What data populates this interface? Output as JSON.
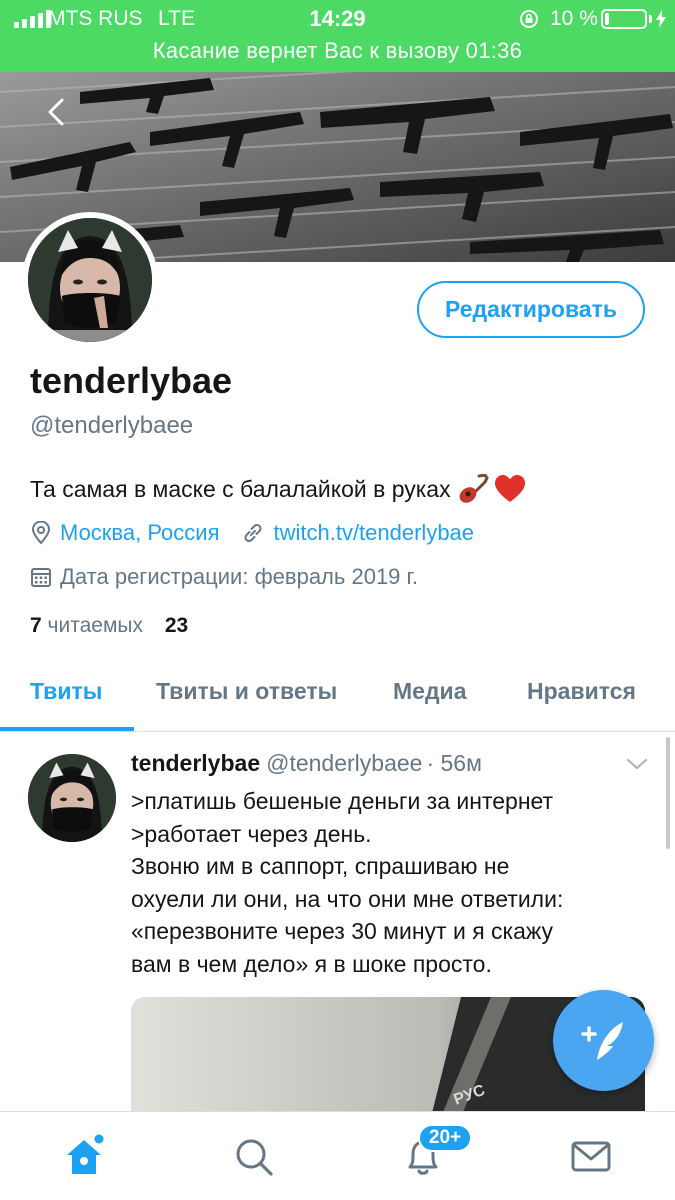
{
  "status_bar": {
    "carrier": "MTS RUS",
    "network": "LTE",
    "time": "14:29",
    "battery_percent": "10 %",
    "battery_level": 0.1,
    "call_banner": "Касание вернет Вас к вызову 01:36",
    "color": "#4cd964"
  },
  "profile": {
    "display_name": "tenderlybae",
    "handle": "@tenderlybaee",
    "edit_label": "Редактировать",
    "bio": "Та самая в маске с балалайкой в руках",
    "bio_emoji": [
      "guitar-emoji",
      "heart-emoji"
    ],
    "location": "Москва, Россия",
    "url": "twitch.tv/tenderlybae",
    "joined": "Дата регистрации: февраль 2019 г.",
    "following_count": "7",
    "following_label": "читаемых",
    "followers_count": "23"
  },
  "tabs": [
    {
      "label": "Твиты",
      "active": true
    },
    {
      "label": "Твиты и ответы",
      "active": false
    },
    {
      "label": "Медиа",
      "active": false
    },
    {
      "label": "Нравится",
      "active": false
    }
  ],
  "tweet": {
    "name": "tenderlybae",
    "handle": "@tenderlybaee",
    "time": "· 56м",
    "lines": [
      ">платишь бешеные деньги за интернет",
      ">работает через день.",
      "Звоню им в саппорт, спрашиваю не",
      "охуели ли они, на что они мне ответили:",
      "«перезвоните через 30 минут и я скажу",
      "вам в чем дело» я в шоке просто."
    ],
    "media_label": "РУС"
  },
  "bottom_nav": {
    "items": [
      "home-icon",
      "search-icon",
      "notifications-icon",
      "messages-icon"
    ],
    "notifications_badge": "20+"
  },
  "colors": {
    "accent": "#1da1f2",
    "secondary_text": "#657786",
    "fab": "#4aa6f0"
  }
}
